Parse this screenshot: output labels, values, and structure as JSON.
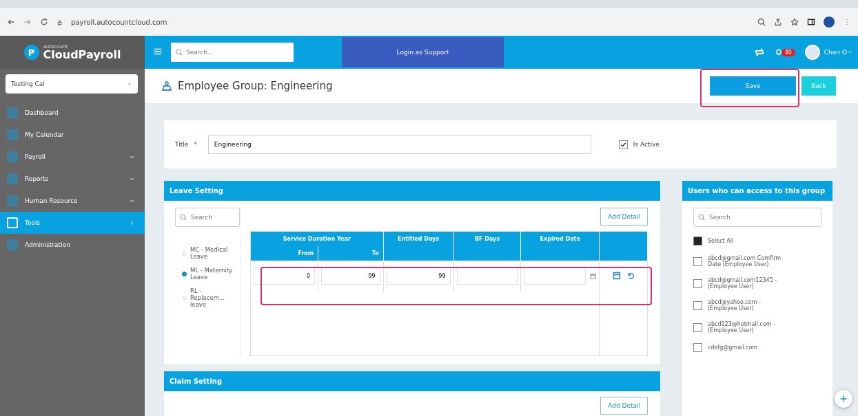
{
  "browser": {
    "url": "payroll.autocountcloud.com"
  },
  "header": {
    "logo_small": "autocount",
    "logo": "CloudPayroll",
    "logo_letter": "P",
    "search_placeholder": "Search...",
    "support_button": "Login as Support",
    "notification_count": "40",
    "user": "Chen O"
  },
  "sidebar": {
    "company": "Testing Cal",
    "items": [
      {
        "label": "Dashboard",
        "selected": false,
        "kind": "link"
      },
      {
        "label": "My Calendar",
        "selected": false,
        "kind": "link"
      },
      {
        "label": "Payroll",
        "selected": false,
        "kind": "menu"
      },
      {
        "label": "Reports",
        "selected": false,
        "kind": "menu"
      },
      {
        "label": "Human Resource",
        "selected": false,
        "kind": "menu"
      },
      {
        "label": "Tools",
        "selected": true,
        "kind": "submenu"
      },
      {
        "label": "Administration",
        "selected": false,
        "kind": "link"
      }
    ]
  },
  "page": {
    "title": "Employee Group: Engineering",
    "buttons": [
      {
        "label": "Save",
        "kind": "primary"
      },
      {
        "label": "Back",
        "kind": "secondary"
      }
    ]
  },
  "form": {
    "title_label": "Title",
    "required_mark": "*",
    "title_value": "Engineering",
    "is_active": {
      "label": "Is Active",
      "checked": true
    }
  },
  "leave_setting": {
    "title": "Leave Setting",
    "search_placeholder": "Search",
    "add_button": "Add Detail",
    "leave_types": [
      {
        "label": "MC - Medical Leave",
        "selected": false
      },
      {
        "label": "ML - Maternity Leave",
        "selected": true
      },
      {
        "label": "RL - Replacem... leave",
        "selected": false
      }
    ],
    "group_column": "Service Duration Year",
    "sub_columns": [
      "From",
      "To"
    ],
    "columns": [
      "Entitled Days",
      "BF Days",
      "Expired Date"
    ],
    "rows": [
      {
        "from": "0",
        "to": "99",
        "entitled_days": "99",
        "bf_days": "",
        "expired_date": ""
      }
    ]
  },
  "claim_setting": {
    "title": "Claim Setting",
    "add_button": "Add Detail"
  },
  "users_panel": {
    "title": "Users who can access to this group",
    "search_placeholder": "Search",
    "select_all": {
      "label": "Select All",
      "checked": true
    },
    "users": [
      {
        "label": "abcd@gmail.com Comfirm Date (Employee User)",
        "checked": false
      },
      {
        "label": "abcd@gmail.com12345 - (Employee User)",
        "checked": false
      },
      {
        "label": "abcd@yahoo.com - (Employee User)",
        "checked": false
      },
      {
        "label": "abcd123@hotmail.com - (Employee User)",
        "checked": false
      },
      {
        "label": "cdefg@gmail.com",
        "checked": false
      }
    ]
  }
}
